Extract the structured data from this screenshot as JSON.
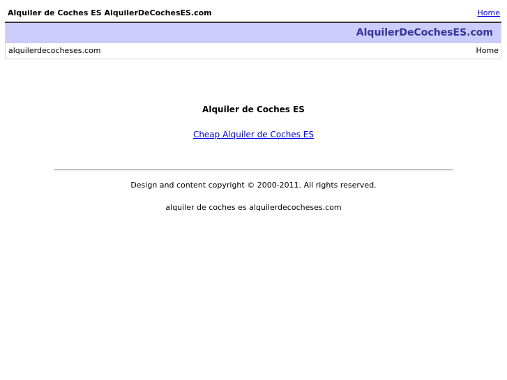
{
  "topbar": {
    "site_title": "Alquiler de Coches ES AlquilerDeCochesES.com",
    "home_link": "Home"
  },
  "header": {
    "banner_title": "AlquilerDeCochesES.com",
    "banner_color": "#ccccff",
    "banner_text_color": "#333399",
    "nav": {
      "domain": "alquilerdecocheses.com",
      "home": "Home"
    }
  },
  "main": {
    "heading": "Alquiler de Coches ES",
    "link_text": "Cheap Alquiler de Coches ES"
  },
  "footer": {
    "copyright": "Design and content copyright © 2000-2011. All rights reserved.",
    "text": "alquiler de coches es alquilerdecocheses.com"
  }
}
